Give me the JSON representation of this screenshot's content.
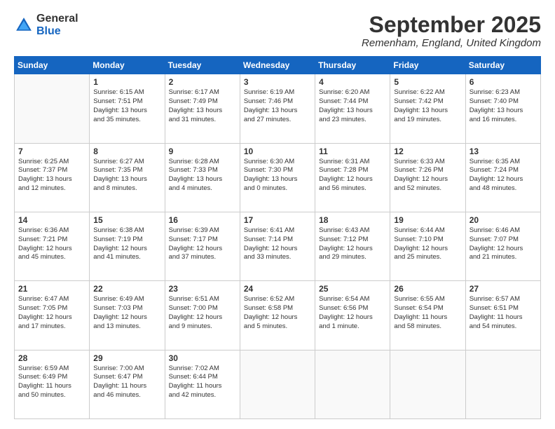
{
  "header": {
    "logo_general": "General",
    "logo_blue": "Blue",
    "month_title": "September 2025",
    "location": "Remenham, England, United Kingdom"
  },
  "weekdays": [
    "Sunday",
    "Monday",
    "Tuesday",
    "Wednesday",
    "Thursday",
    "Friday",
    "Saturday"
  ],
  "weeks": [
    [
      {
        "day": "",
        "text": ""
      },
      {
        "day": "1",
        "text": "Sunrise: 6:15 AM\nSunset: 7:51 PM\nDaylight: 13 hours\nand 35 minutes."
      },
      {
        "day": "2",
        "text": "Sunrise: 6:17 AM\nSunset: 7:49 PM\nDaylight: 13 hours\nand 31 minutes."
      },
      {
        "day": "3",
        "text": "Sunrise: 6:19 AM\nSunset: 7:46 PM\nDaylight: 13 hours\nand 27 minutes."
      },
      {
        "day": "4",
        "text": "Sunrise: 6:20 AM\nSunset: 7:44 PM\nDaylight: 13 hours\nand 23 minutes."
      },
      {
        "day": "5",
        "text": "Sunrise: 6:22 AM\nSunset: 7:42 PM\nDaylight: 13 hours\nand 19 minutes."
      },
      {
        "day": "6",
        "text": "Sunrise: 6:23 AM\nSunset: 7:40 PM\nDaylight: 13 hours\nand 16 minutes."
      }
    ],
    [
      {
        "day": "7",
        "text": "Sunrise: 6:25 AM\nSunset: 7:37 PM\nDaylight: 13 hours\nand 12 minutes."
      },
      {
        "day": "8",
        "text": "Sunrise: 6:27 AM\nSunset: 7:35 PM\nDaylight: 13 hours\nand 8 minutes."
      },
      {
        "day": "9",
        "text": "Sunrise: 6:28 AM\nSunset: 7:33 PM\nDaylight: 13 hours\nand 4 minutes."
      },
      {
        "day": "10",
        "text": "Sunrise: 6:30 AM\nSunset: 7:30 PM\nDaylight: 13 hours\nand 0 minutes."
      },
      {
        "day": "11",
        "text": "Sunrise: 6:31 AM\nSunset: 7:28 PM\nDaylight: 12 hours\nand 56 minutes."
      },
      {
        "day": "12",
        "text": "Sunrise: 6:33 AM\nSunset: 7:26 PM\nDaylight: 12 hours\nand 52 minutes."
      },
      {
        "day": "13",
        "text": "Sunrise: 6:35 AM\nSunset: 7:24 PM\nDaylight: 12 hours\nand 48 minutes."
      }
    ],
    [
      {
        "day": "14",
        "text": "Sunrise: 6:36 AM\nSunset: 7:21 PM\nDaylight: 12 hours\nand 45 minutes."
      },
      {
        "day": "15",
        "text": "Sunrise: 6:38 AM\nSunset: 7:19 PM\nDaylight: 12 hours\nand 41 minutes."
      },
      {
        "day": "16",
        "text": "Sunrise: 6:39 AM\nSunset: 7:17 PM\nDaylight: 12 hours\nand 37 minutes."
      },
      {
        "day": "17",
        "text": "Sunrise: 6:41 AM\nSunset: 7:14 PM\nDaylight: 12 hours\nand 33 minutes."
      },
      {
        "day": "18",
        "text": "Sunrise: 6:43 AM\nSunset: 7:12 PM\nDaylight: 12 hours\nand 29 minutes."
      },
      {
        "day": "19",
        "text": "Sunrise: 6:44 AM\nSunset: 7:10 PM\nDaylight: 12 hours\nand 25 minutes."
      },
      {
        "day": "20",
        "text": "Sunrise: 6:46 AM\nSunset: 7:07 PM\nDaylight: 12 hours\nand 21 minutes."
      }
    ],
    [
      {
        "day": "21",
        "text": "Sunrise: 6:47 AM\nSunset: 7:05 PM\nDaylight: 12 hours\nand 17 minutes."
      },
      {
        "day": "22",
        "text": "Sunrise: 6:49 AM\nSunset: 7:03 PM\nDaylight: 12 hours\nand 13 minutes."
      },
      {
        "day": "23",
        "text": "Sunrise: 6:51 AM\nSunset: 7:00 PM\nDaylight: 12 hours\nand 9 minutes."
      },
      {
        "day": "24",
        "text": "Sunrise: 6:52 AM\nSunset: 6:58 PM\nDaylight: 12 hours\nand 5 minutes."
      },
      {
        "day": "25",
        "text": "Sunrise: 6:54 AM\nSunset: 6:56 PM\nDaylight: 12 hours\nand 1 minute."
      },
      {
        "day": "26",
        "text": "Sunrise: 6:55 AM\nSunset: 6:54 PM\nDaylight: 11 hours\nand 58 minutes."
      },
      {
        "day": "27",
        "text": "Sunrise: 6:57 AM\nSunset: 6:51 PM\nDaylight: 11 hours\nand 54 minutes."
      }
    ],
    [
      {
        "day": "28",
        "text": "Sunrise: 6:59 AM\nSunset: 6:49 PM\nDaylight: 11 hours\nand 50 minutes."
      },
      {
        "day": "29",
        "text": "Sunrise: 7:00 AM\nSunset: 6:47 PM\nDaylight: 11 hours\nand 46 minutes."
      },
      {
        "day": "30",
        "text": "Sunrise: 7:02 AM\nSunset: 6:44 PM\nDaylight: 11 hours\nand 42 minutes."
      },
      {
        "day": "",
        "text": ""
      },
      {
        "day": "",
        "text": ""
      },
      {
        "day": "",
        "text": ""
      },
      {
        "day": "",
        "text": ""
      }
    ]
  ]
}
